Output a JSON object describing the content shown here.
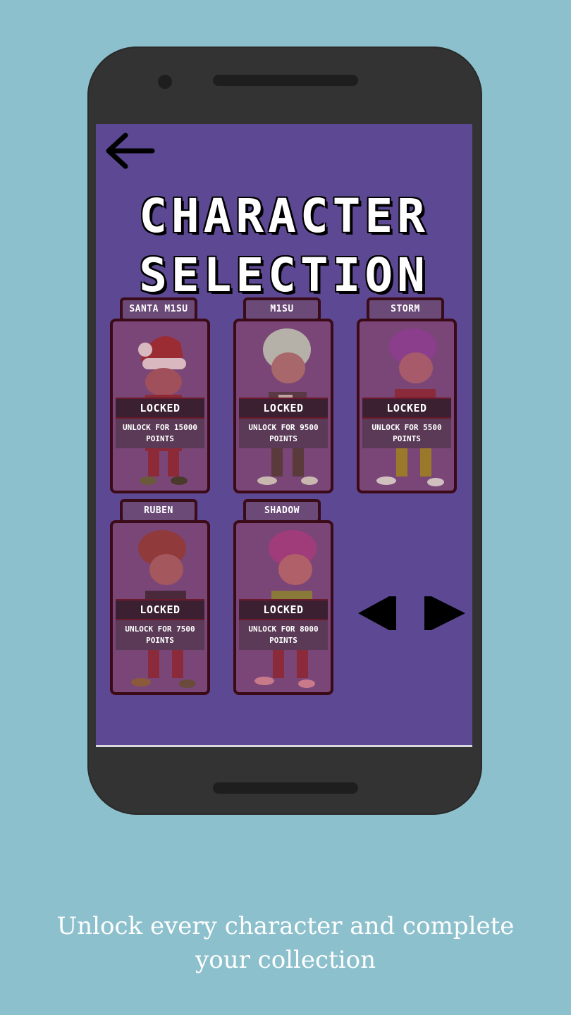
{
  "screen": {
    "title_line1": "CHARACTER",
    "title_line2": "SELECTION"
  },
  "characters": [
    {
      "name": "SANTA M1SU",
      "status": "LOCKED",
      "unlock_line1": "UNLOCK FOR 15000",
      "unlock_line2": "POINTS"
    },
    {
      "name": "M1SU",
      "status": "LOCKED",
      "unlock_line1": "UNLOCK FOR 9500",
      "unlock_line2": "POINTS"
    },
    {
      "name": "STORM",
      "status": "LOCKED",
      "unlock_line1": "UNLOCK FOR 5500",
      "unlock_line2": "POINTS"
    },
    {
      "name": "RUBEN",
      "status": "LOCKED",
      "unlock_line1": "UNLOCK FOR 7500",
      "unlock_line2": "POINTS"
    },
    {
      "name": "SHADOW",
      "status": "LOCKED",
      "unlock_line1": "UNLOCK FOR 8000",
      "unlock_line2": "POINTS"
    }
  ],
  "icons": {
    "back": "arrow-left-icon",
    "prev": "triangle-left-icon",
    "next": "triangle-right-icon"
  },
  "colors": {
    "background": "#8dc0cd",
    "screen": "#5d4893",
    "card_border": "#3b0a16"
  },
  "caption": {
    "line1": "Unlock every character and complete",
    "line2": "your collection"
  }
}
